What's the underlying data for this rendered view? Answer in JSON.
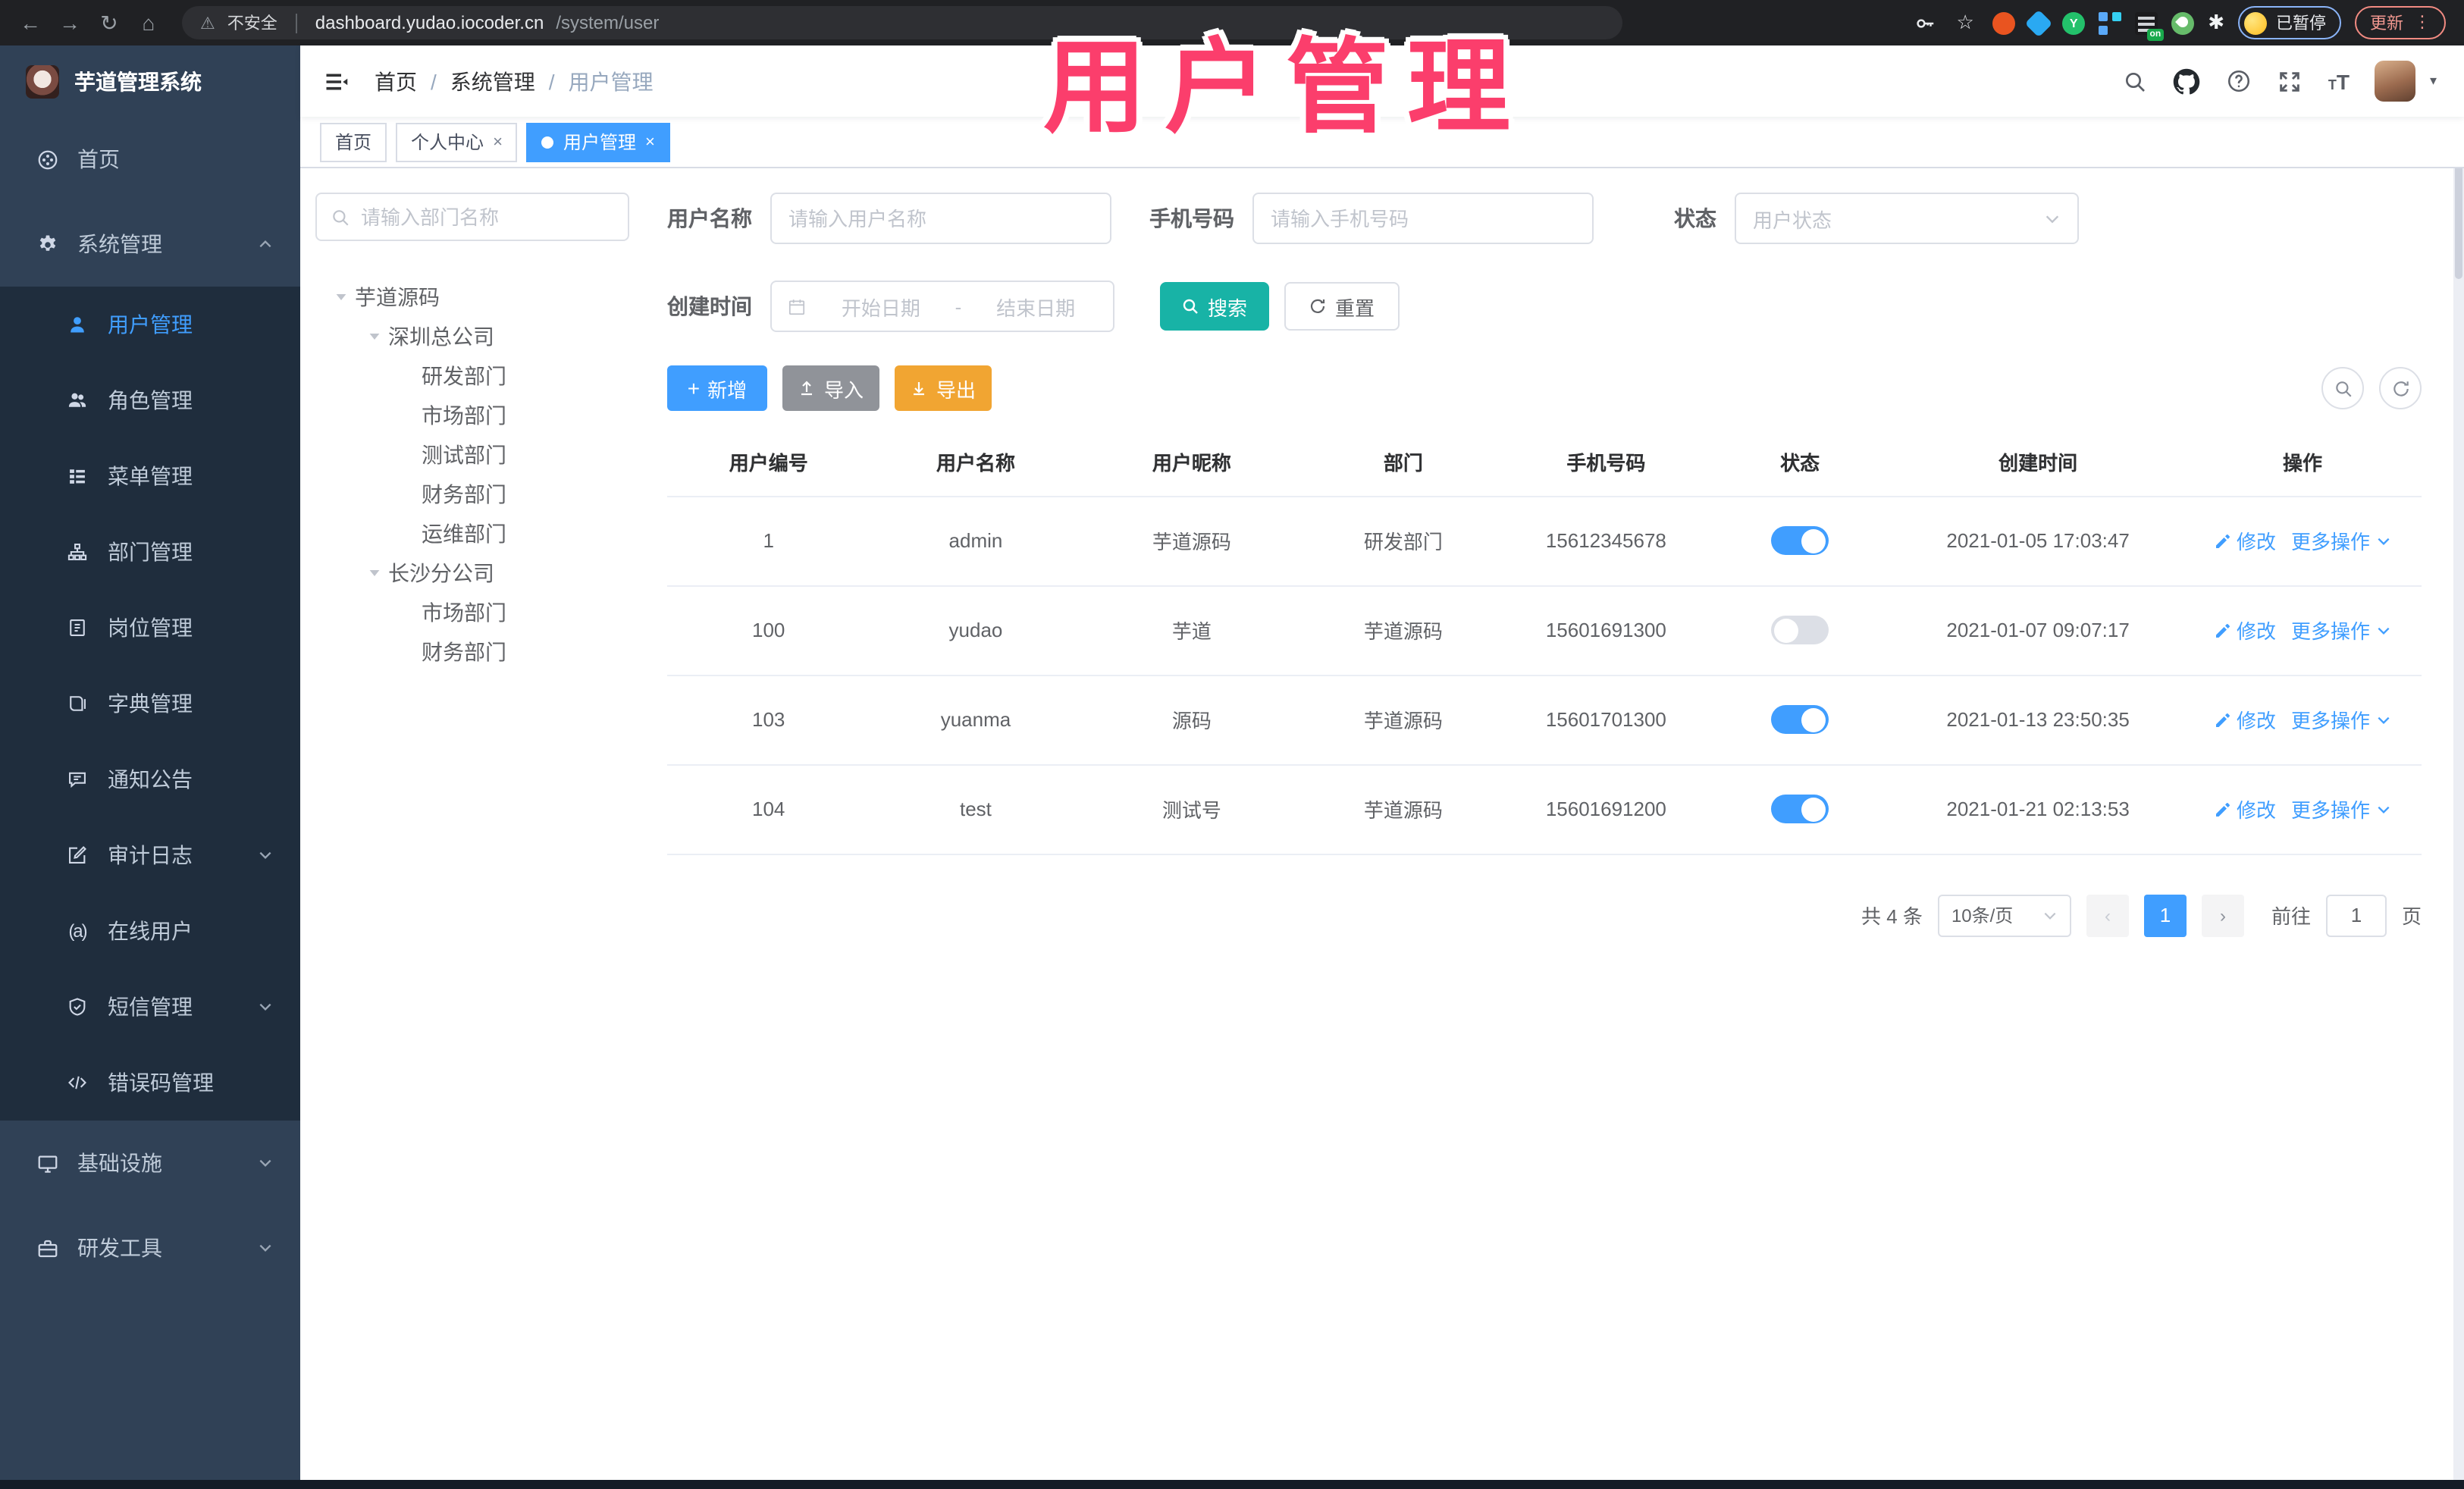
{
  "colors": {
    "primary": "#409eff",
    "search_teal": "#18b3a6",
    "export_orange": "#f1a532",
    "import_gray": "#909399",
    "overlay_pink": "#fb3e6c",
    "sidebar_bg": "#304156",
    "submenu_bg": "#1f2d3d"
  },
  "overlay": {
    "title": "用户管理"
  },
  "browser": {
    "security_label": "不安全",
    "url_host": "dashboard.yudao.iocoder.cn",
    "url_path": "/system/user",
    "ext_on_badge": "on",
    "paused_badge": "已暂停",
    "update_button": "更新"
  },
  "app": {
    "logo_title": "芋道管理系统",
    "breadcrumb": {
      "items": [
        "首页",
        "系统管理",
        "用户管理"
      ],
      "separator": "/"
    },
    "tabs": [
      {
        "label": "首页",
        "active": false,
        "closable": false
      },
      {
        "label": "个人中心",
        "active": false,
        "closable": true
      },
      {
        "label": "用户管理",
        "active": true,
        "closable": true
      }
    ],
    "tab_close_glyph": "×",
    "sidebar": {
      "home": "首页",
      "system_group": "系统管理",
      "system_children": [
        "用户管理",
        "角色管理",
        "菜单管理",
        "部门管理",
        "岗位管理",
        "字典管理",
        "通知公告",
        "审计日志",
        "在线用户",
        "短信管理",
        "错误码管理"
      ],
      "active_child": "用户管理",
      "infra_group": "基础设施",
      "dev_group": "研发工具"
    },
    "dept_tree": {
      "search_placeholder": "请输入部门名称",
      "root": "芋道源码",
      "branches": [
        {
          "label": "深圳总公司",
          "children": [
            "研发部门",
            "市场部门",
            "测试部门",
            "财务部门",
            "运维部门"
          ]
        },
        {
          "label": "长沙分公司",
          "children": [
            "市场部门",
            "财务部门"
          ]
        }
      ]
    },
    "filter": {
      "username_label": "用户名称",
      "username_placeholder": "请输入用户名称",
      "mobile_label": "手机号码",
      "mobile_placeholder": "请输入手机号码",
      "status_label": "状态",
      "status_placeholder": "用户状态",
      "create_time_label": "创建时间",
      "date_start_placeholder": "开始日期",
      "date_separator": "-",
      "date_end_placeholder": "结束日期",
      "search_button": "搜索",
      "reset_button": "重置"
    },
    "toolbar": {
      "add": "新增",
      "import": "导入",
      "export": "导出"
    },
    "table": {
      "headers": [
        "用户编号",
        "用户名称",
        "用户昵称",
        "部门",
        "手机号码",
        "状态",
        "创建时间",
        "操作"
      ],
      "row_actions": {
        "edit": "修改",
        "more": "更多操作"
      },
      "rows": [
        {
          "id": "1",
          "username": "admin",
          "nickname": "芋道源码",
          "dept": "研发部门",
          "mobile": "15612345678",
          "status": "on",
          "created": "2021-01-05 17:03:47"
        },
        {
          "id": "100",
          "username": "yudao",
          "nickname": "芋道",
          "dept": "芋道源码",
          "mobile": "15601691300",
          "status": "off",
          "created": "2021-01-07 09:07:17"
        },
        {
          "id": "103",
          "username": "yuanma",
          "nickname": "源码",
          "dept": "芋道源码",
          "mobile": "15601701300",
          "status": "on",
          "created": "2021-01-13 23:50:35"
        },
        {
          "id": "104",
          "username": "test",
          "nickname": "测试号",
          "dept": "芋道源码",
          "mobile": "15601691200",
          "status": "on",
          "created": "2021-01-21 02:13:53"
        }
      ]
    },
    "pagination": {
      "total_text": "共 4 条",
      "page_size": "10条/页",
      "current_page": "1",
      "goto_label": "前往",
      "goto_value": "1",
      "page_unit": "页"
    }
  }
}
